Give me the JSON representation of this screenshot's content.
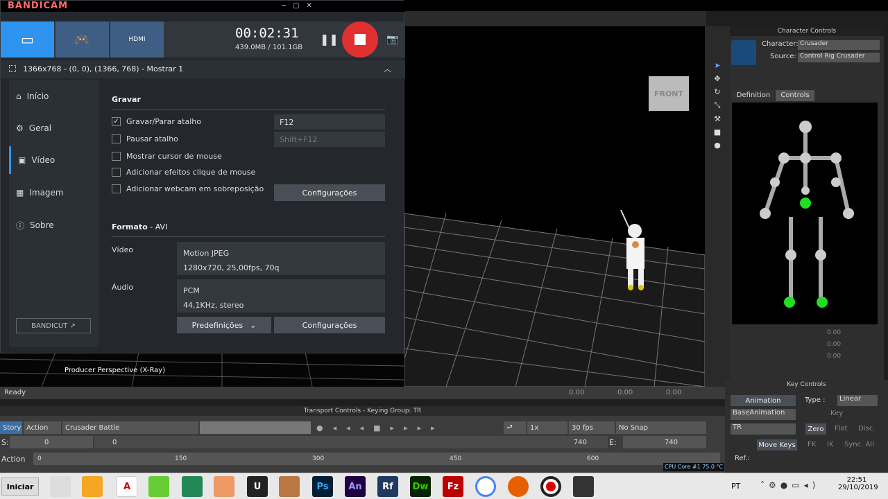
{
  "app": {
    "title": "BANDICAM"
  },
  "recorder": {
    "timer": "00:02:31",
    "filesize": "439.0MB / 101.1GB",
    "modes": [
      "screen-icon",
      "gamepad-icon",
      "hdmi-icon"
    ],
    "hdmi_label": "HDMI"
  },
  "source": {
    "text": "1366x768 - (0, 0), (1366, 768) - Mostrar 1"
  },
  "sidebar": {
    "items": [
      {
        "label": "Início",
        "icon": "home-icon"
      },
      {
        "label": "Geral",
        "icon": "gear-icon"
      },
      {
        "label": "Vídeo",
        "icon": "video-icon"
      },
      {
        "label": "Imagem",
        "icon": "image-icon"
      },
      {
        "label": "Sobre",
        "icon": "info-icon"
      }
    ],
    "bandicut": "BANDICUT ↗"
  },
  "record": {
    "title": "Gravar",
    "options": [
      {
        "label": "Gravar/Parar atalho",
        "checked": true
      },
      {
        "label": "Pausar atalho",
        "checked": false
      },
      {
        "label": "Mostrar cursor de mouse",
        "checked": false
      },
      {
        "label": "Adicionar efeitos clique de mouse",
        "checked": false
      },
      {
        "label": "Adicionar webcam em sobreposição",
        "checked": false
      }
    ],
    "hotkey_record": "F12",
    "hotkey_pause": "Shift+F12",
    "config_btn": "Configurações"
  },
  "format": {
    "title": "Formato",
    "title_suffix": " - AVI",
    "video_label": "Vídeo",
    "video_codec": "Motion JPEG",
    "video_detail": "1280x720, 25,00fps, 70q",
    "audio_label": "Áudio",
    "audio_codec": "PCM",
    "audio_detail": "44,1KHz, stereo",
    "presets_btn": "Predefinições",
    "config_btn": "Configurações"
  },
  "viewport": {
    "label": "Producer Perspective (X-Ray)",
    "cube": "FRONT"
  },
  "status": {
    "text": "Ready",
    "coords": [
      "0.00",
      "0.00",
      "0.00"
    ]
  },
  "character_controls": {
    "title": "Character Controls",
    "character_label": "Character:",
    "character_value": "Crusader",
    "source_label": "Source:",
    "source_value": "Control Rig Crusader",
    "tabs": [
      "Definition",
      "Controls"
    ],
    "values": [
      "0.00",
      "0.00",
      "0.00"
    ]
  },
  "transport": {
    "title": "Transport Controls  -  Keying Group: TR",
    "story": "Story",
    "action": "Action",
    "take": "Crusader Battle",
    "speed": "1x",
    "fps": "30 fps",
    "snap": "No Snap",
    "s_label": "S:",
    "s_value": "0",
    "start_value": "0",
    "end_value": "740",
    "e_label": "E:",
    "e_value": "740",
    "action_label": "Action",
    "ticks": [
      "0",
      "150",
      "300",
      "450",
      "600"
    ],
    "cpu": "CPU Core #1  75.0 °C"
  },
  "key_controls": {
    "title": "Key Controls",
    "animation_btn": "Animation",
    "type_label": "Type :",
    "type_value": "Linear",
    "layer": "BaseAnimation",
    "key_btn": "Key",
    "group": "TR",
    "zero": "Zero",
    "flat": "Flat",
    "disc": "Disc.",
    "move_keys": "Move Keys",
    "fk": "FK",
    "ik": "IK",
    "sync": "Sync. All",
    "ref": "Ref.:"
  },
  "taskbar": {
    "start": "Iniciar",
    "lang": "PT",
    "time": "22:51",
    "date": "29/10/2019",
    "apps": [
      "Ps",
      "An",
      "Rf",
      "Dw",
      "Fz"
    ]
  }
}
